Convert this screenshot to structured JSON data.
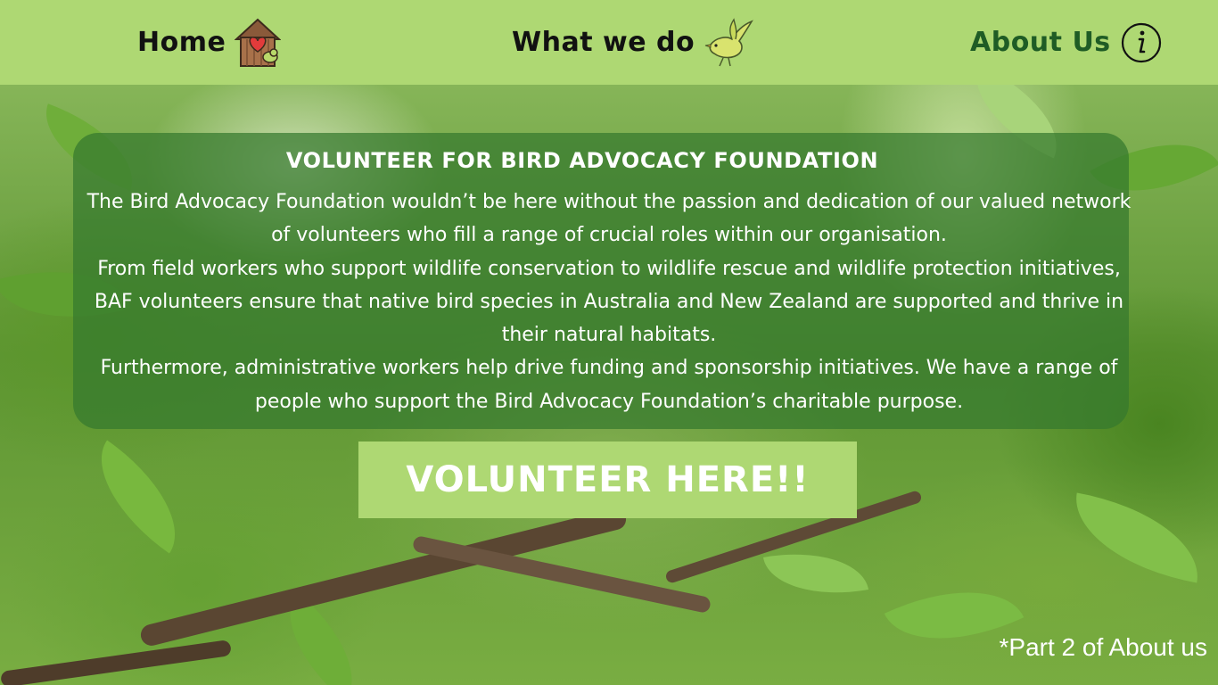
{
  "nav": {
    "home_label": "Home",
    "what_label": "What we do",
    "about_label": "About Us",
    "icons": [
      "birdhouse-heart-icon",
      "bird-icon",
      "info-icon"
    ]
  },
  "panel": {
    "title": "VOLUNTEER FOR BIRD ADVOCACY FOUNDATION",
    "paragraphs": [
      "The Bird Advocacy Foundation wouldn’t be here without the passion and dedication of our valued network of volunteers who fill a range of crucial roles within our organisation.",
      "From field workers who support wildlife conservation to wildlife rescue and wildlife protection initiatives, BAF volunteers ensure that native bird species in Australia and New Zealand are supported and thrive in their natural habitats.",
      "Furthermore, administrative workers help drive funding and sponsorship initiatives. We have a range of people who support the Bird Advocacy Foundation’s charitable purpose."
    ]
  },
  "cta": {
    "label": "VOLUNTEER HERE!!"
  },
  "footnote": "*Part 2 of About us",
  "colors": {
    "nav_bg": "#aed873",
    "panel_bg": "#34782e",
    "about_text": "#1f5c25",
    "cta_bg": "#aed873"
  }
}
